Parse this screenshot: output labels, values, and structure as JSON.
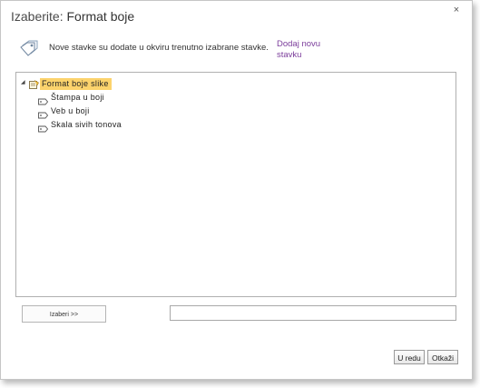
{
  "dialog": {
    "title_prefix": "Izaberite:",
    "title_name": "Format boje",
    "close_glyph": "×"
  },
  "info": {
    "icon": "tags-icon",
    "message": "Nove stavke su dodate u okviru trenutno izabrane stavke.",
    "add_link": "Dodaj novu stavku"
  },
  "tree": {
    "root": {
      "label": "Format boje slike",
      "expanded": true,
      "selected": true,
      "icon": "term-set-icon"
    },
    "children": [
      {
        "label": "Štampa u boji",
        "icon": "term-icon"
      },
      {
        "label": "Veb u boji",
        "icon": "term-icon"
      },
      {
        "label": "Skala sivih tonova",
        "icon": "term-icon"
      }
    ]
  },
  "selection": {
    "select_button": "Izaberi >>",
    "value": ""
  },
  "footer": {
    "ok_label": "U redu",
    "cancel_label": "Otkaži"
  },
  "colors": {
    "selected_highlight": "#fcd36c",
    "link": "#7b3d9b"
  }
}
